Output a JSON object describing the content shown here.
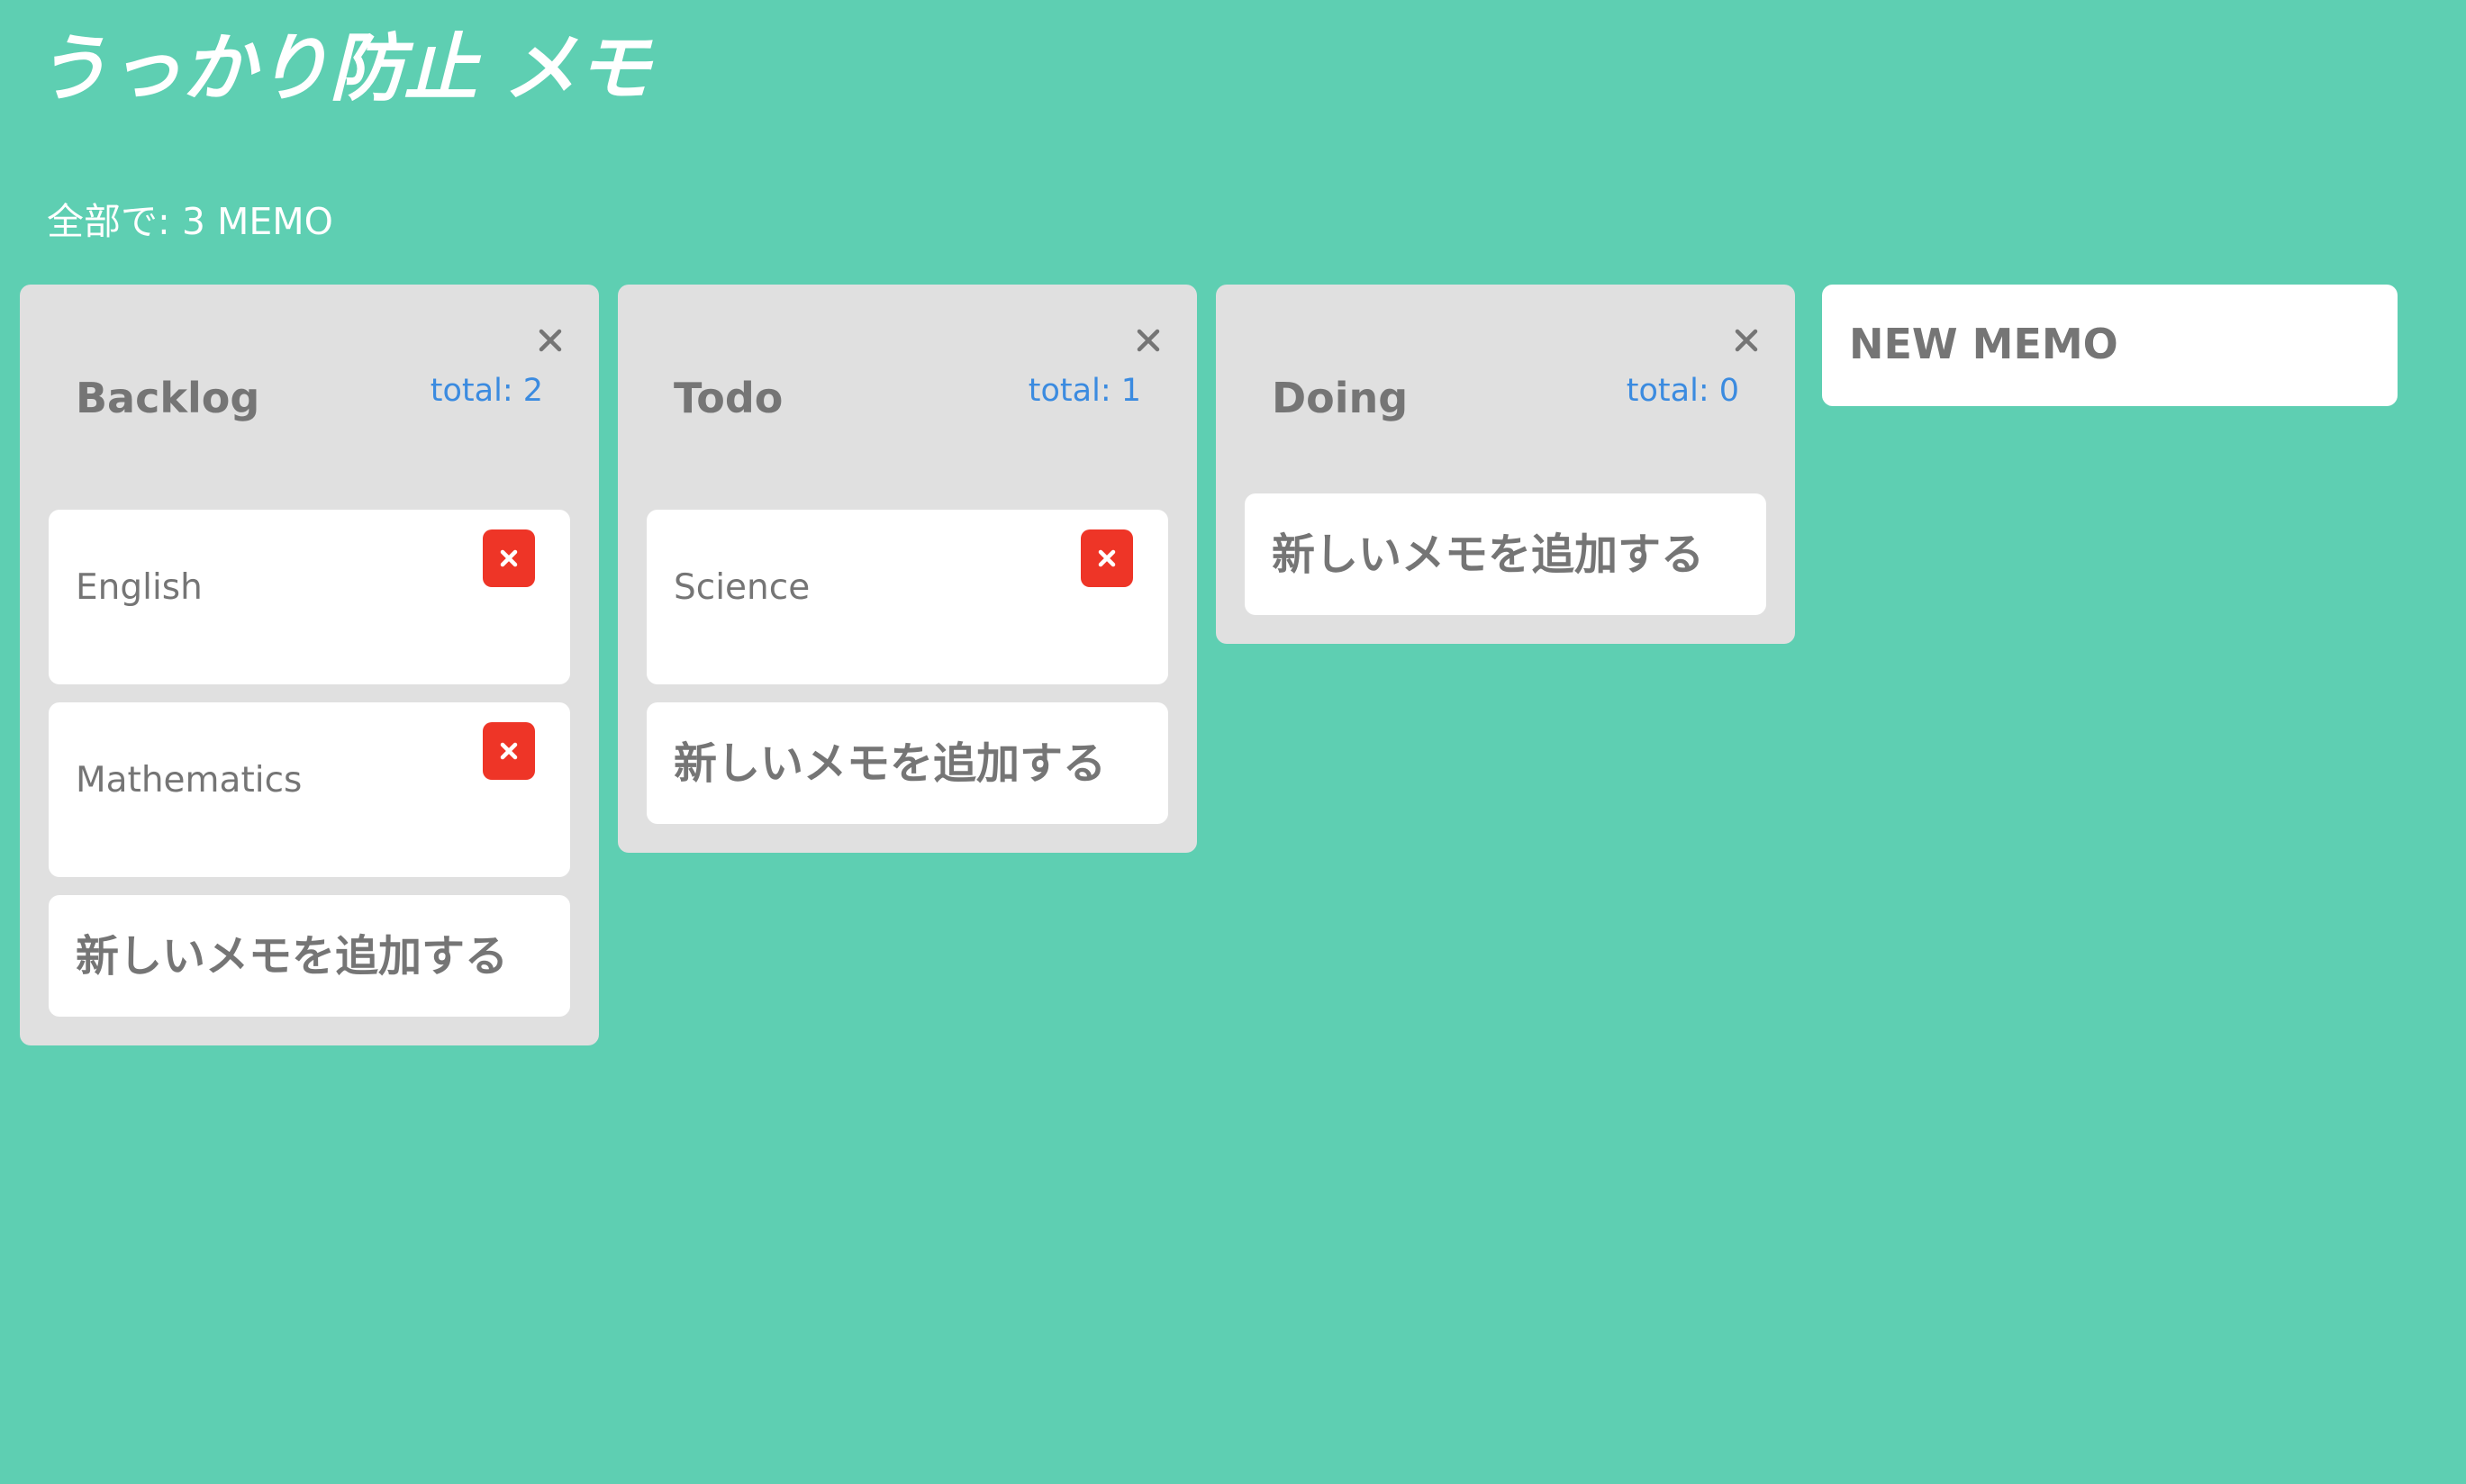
{
  "app": {
    "title": "うっかり防止 メモ",
    "summary": "全部で: 3 MEMO"
  },
  "colors": {
    "background": "#5ecfb2",
    "column": "#e0e0e0",
    "card": "#ffffff",
    "text": "#757575",
    "total": "#3b8be0",
    "delete": "#ee3527"
  },
  "columns": [
    {
      "title": "Backlog",
      "total": "total: 2",
      "close_icon": "close-icon",
      "memos": [
        {
          "text": "English",
          "delete_icon": "delete-icon"
        },
        {
          "text": "Mathematics",
          "delete_icon": "delete-icon"
        }
      ],
      "add_label": "新しいメモを追加する"
    },
    {
      "title": "Todo",
      "total": "total: 1",
      "close_icon": "close-icon",
      "memos": [
        {
          "text": "Science",
          "delete_icon": "delete-icon"
        }
      ],
      "add_label": "新しいメモを追加する"
    },
    {
      "title": "Doing",
      "total": "total: 0",
      "close_icon": "close-icon",
      "memos": [],
      "add_label": "新しいメモを追加する"
    }
  ],
  "new_memo": {
    "label": "NEW MEMO"
  }
}
